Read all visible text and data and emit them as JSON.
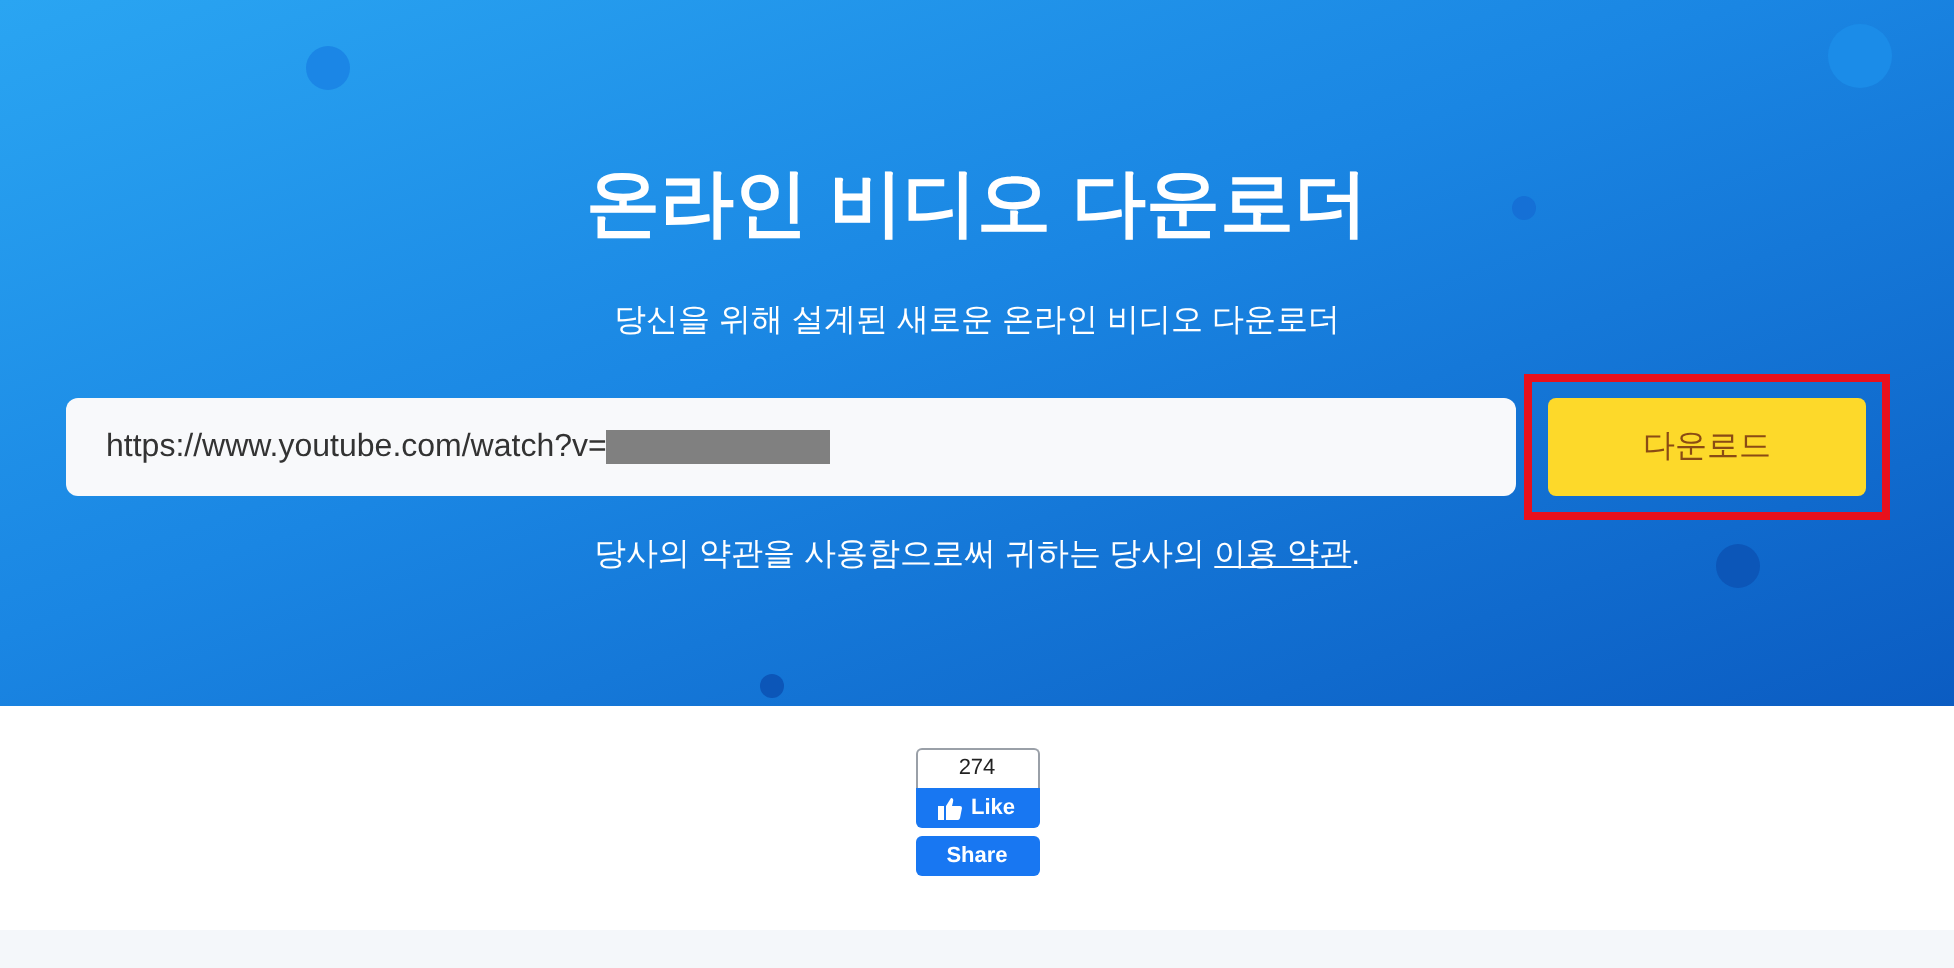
{
  "hero": {
    "title": "온라인 비디오 다운로더",
    "subtitle": "당신을 위해 설계된 새로운 온라인 비디오 다운로더",
    "url_field": {
      "value": "https://www.youtube.com/watch?v=",
      "redacted": true
    },
    "download_button": {
      "label": "다운로드",
      "highlighted": true
    },
    "terms": {
      "text": "당사의 약관을 사용함으로써 귀하는 당사의 ",
      "link": "이용 약관",
      "end": "."
    }
  },
  "like_widget": {
    "count": "274",
    "like": "Like",
    "share": "Share"
  }
}
